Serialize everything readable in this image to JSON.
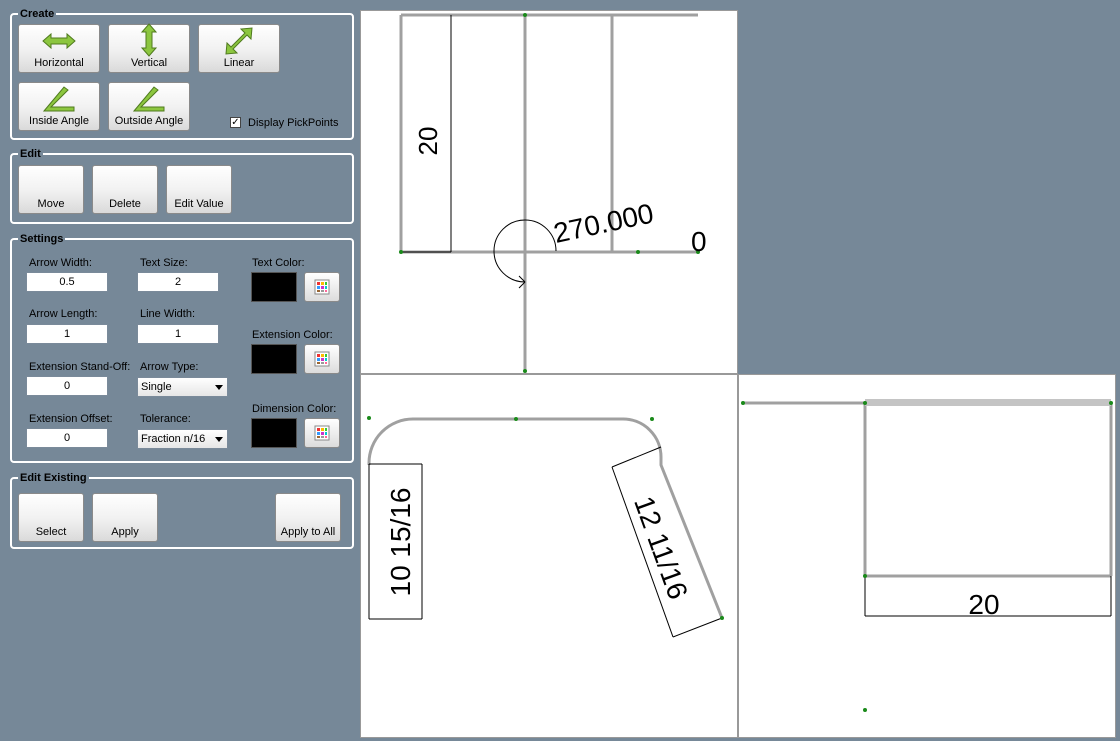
{
  "create": {
    "title": "Create",
    "horizontal": "Horizontal",
    "vertical": "Vertical",
    "linear": "Linear",
    "inside_angle": "Inside Angle",
    "outside_angle": "Outside Angle",
    "display_pickpoints": "Display PickPoints",
    "display_pickpoints_checked": true
  },
  "edit": {
    "title": "Edit",
    "move": "Move",
    "delete": "Delete",
    "edit_value": "Edit Value"
  },
  "settings": {
    "title": "Settings",
    "arrow_width_label": "Arrow Width:",
    "arrow_width": "0.5",
    "text_size_label": "Text Size:",
    "text_size": "2",
    "arrow_length_label": "Arrow Length:",
    "arrow_length": "1",
    "line_width_label": "Line Width:",
    "line_width": "1",
    "ext_standoff_label": "Extension Stand-Off:",
    "ext_standoff": "0",
    "arrow_type_label": "Arrow Type:",
    "arrow_type": "Single",
    "ext_offset_label": "Extension Offset:",
    "ext_offset": "0",
    "tolerance_label": "Tolerance:",
    "tolerance": "Fraction n/16",
    "text_color_label": "Text Color:",
    "text_color": "#000000",
    "extension_color_label": "Extension Color:",
    "extension_color": "#000000",
    "dimension_color_label": "Dimension Color:",
    "dimension_color": "#000000"
  },
  "edit_existing": {
    "title": "Edit Existing",
    "select": "Select",
    "apply": "Apply",
    "apply_all": "Apply to All"
  },
  "viewports": {
    "top": {
      "dim_vertical": "20",
      "angle": "270.000",
      "zero": "0"
    },
    "bottom_left": {
      "dim_left": "10 15/16",
      "dim_right": "12 11/16"
    },
    "bottom_right": {
      "dim_bottom": "20"
    }
  },
  "colors": {
    "panel_bg": "#768898",
    "icon_green": "#8cc63f",
    "geometry_gray": "#a0a0a0",
    "pickpoint": "#1a8a1a"
  }
}
